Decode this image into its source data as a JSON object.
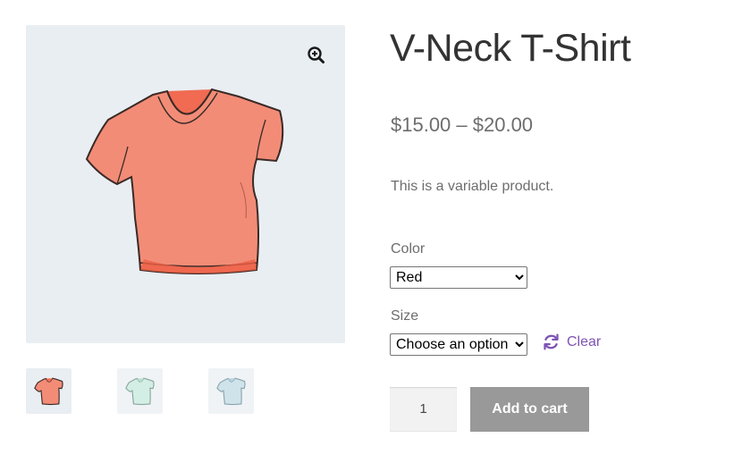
{
  "product": {
    "title": "V-Neck T-Shirt",
    "price": "$15.00 – $20.00",
    "description": "This is a variable product."
  },
  "gallery": {
    "zoom_icon": "zoom-in-icon",
    "thumbnails": [
      {
        "name": "red-shirt-thumbnail",
        "color": "#f28c77"
      },
      {
        "name": "green-shirt-thumbnail",
        "color": "#d3eee4"
      },
      {
        "name": "blue-shirt-thumbnail",
        "color": "#cfe3ea"
      }
    ]
  },
  "variations": {
    "color": {
      "label": "Color",
      "selected": "Red"
    },
    "size": {
      "label": "Size",
      "selected": "Choose an option"
    },
    "clear_label": "Clear",
    "clear_icon": "refresh-icon"
  },
  "cart": {
    "quantity": "1",
    "add_label": "Add to cart"
  },
  "colors": {
    "accent": "#7f54b3",
    "button_disabled": "#999999",
    "gallery_bg": "#e9eef2"
  }
}
